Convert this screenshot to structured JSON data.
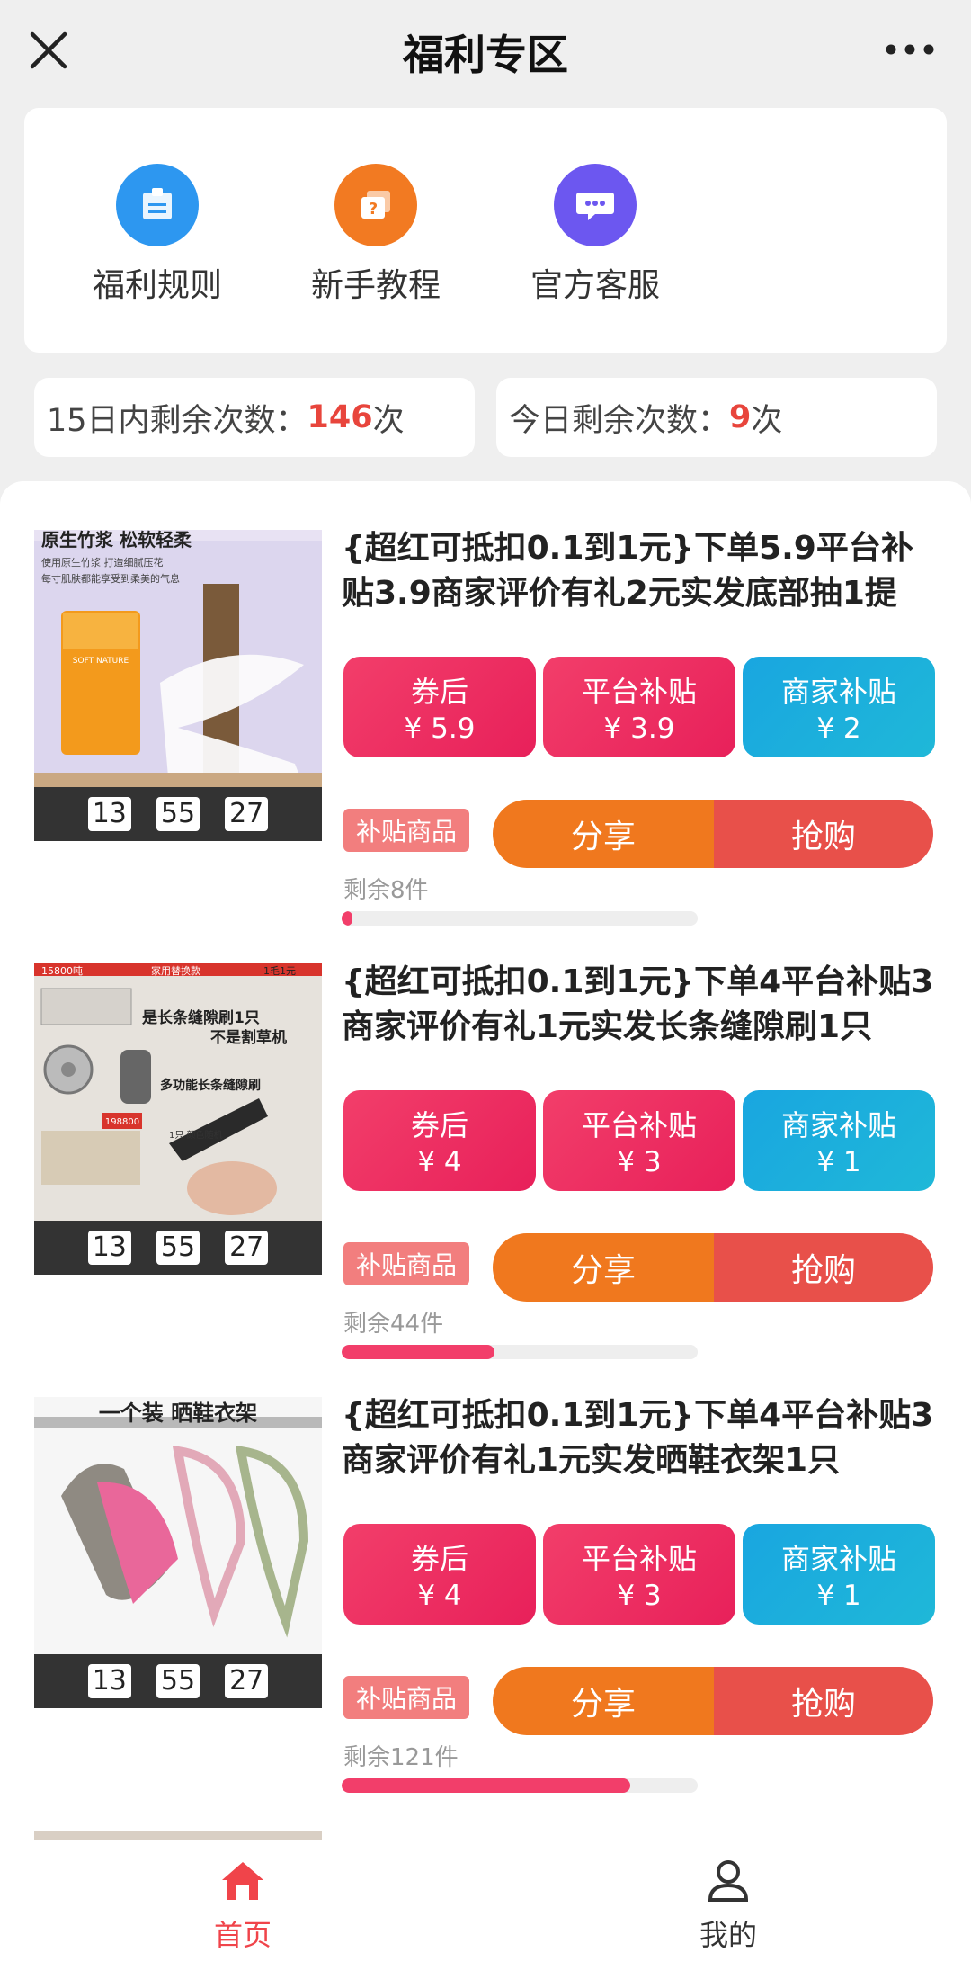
{
  "header": {
    "title": "福利专区",
    "close_icon": "close-icon",
    "more_icon": "more-icon"
  },
  "shortcuts": [
    {
      "label": "福利规则",
      "icon": "rules-icon",
      "color": "#2d97f0"
    },
    {
      "label": "新手教程",
      "icon": "tutorial-icon",
      "color": "#f27a22"
    },
    {
      "label": "官方客服",
      "icon": "service-icon",
      "color": "#6c57f0"
    }
  ],
  "counters": {
    "fifteen_day": {
      "label": "15日内剩余次数：",
      "value": "146",
      "unit": "次"
    },
    "today": {
      "label": "今日剩余次数：",
      "value": "9",
      "unit": "次"
    }
  },
  "common": {
    "after_coupon": "券后",
    "platform_subsidy": "平台补贴",
    "merchant_subsidy": "商家补贴",
    "tag": "补贴商品",
    "share": "分享",
    "buy": "抢购",
    "timer": [
      "13",
      "55",
      "27"
    ]
  },
  "products": [
    {
      "title": "{超红可抵扣0.1到1元}下单5.9平台补贴3.9商家评价有礼2元实发底部抽1提",
      "price_after_coupon": "¥ 5.9",
      "price_platform": "¥ 3.9",
      "price_merchant": "¥ 2",
      "remaining": "剩余8件",
      "progress": 0.03,
      "image_text": [
        "原生竹浆 松软轻柔",
        "使用原生竹浆 打造细腻压花",
        "每寸肌肤都能享受到柔美的气息",
        "SOFT NATURE"
      ]
    },
    {
      "title": "{超红可抵扣0.1到1元}下单4平台补贴3商家评价有礼1元实发长条缝隙刷1只",
      "price_after_coupon": "¥ 4",
      "price_platform": "¥ 3",
      "price_merchant": "¥ 1",
      "remaining": "剩余44件",
      "progress": 0.43,
      "image_text": [
        "15800吨",
        "家用替换款",
        "1毛1元",
        "是长条缝隙刷1只",
        "不是割草机",
        "多功能长条缝隙刷",
        "198800",
        "1只 颜色随机"
      ]
    },
    {
      "title": "{超红可抵扣0.1到1元}下单4平台补贴3商家评价有礼1元实发晒鞋衣架1只",
      "price_after_coupon": "¥ 4",
      "price_platform": "¥ 3",
      "price_merchant": "¥ 1",
      "remaining": "剩余121件",
      "progress": 0.81,
      "image_text": [
        "一个装 晒鞋衣架"
      ]
    }
  ],
  "nav": [
    {
      "label": "首页",
      "icon": "home-icon",
      "active": true,
      "color": "#f0444a"
    },
    {
      "label": "我的",
      "icon": "user-icon",
      "active": false,
      "color": "#333333"
    }
  ]
}
